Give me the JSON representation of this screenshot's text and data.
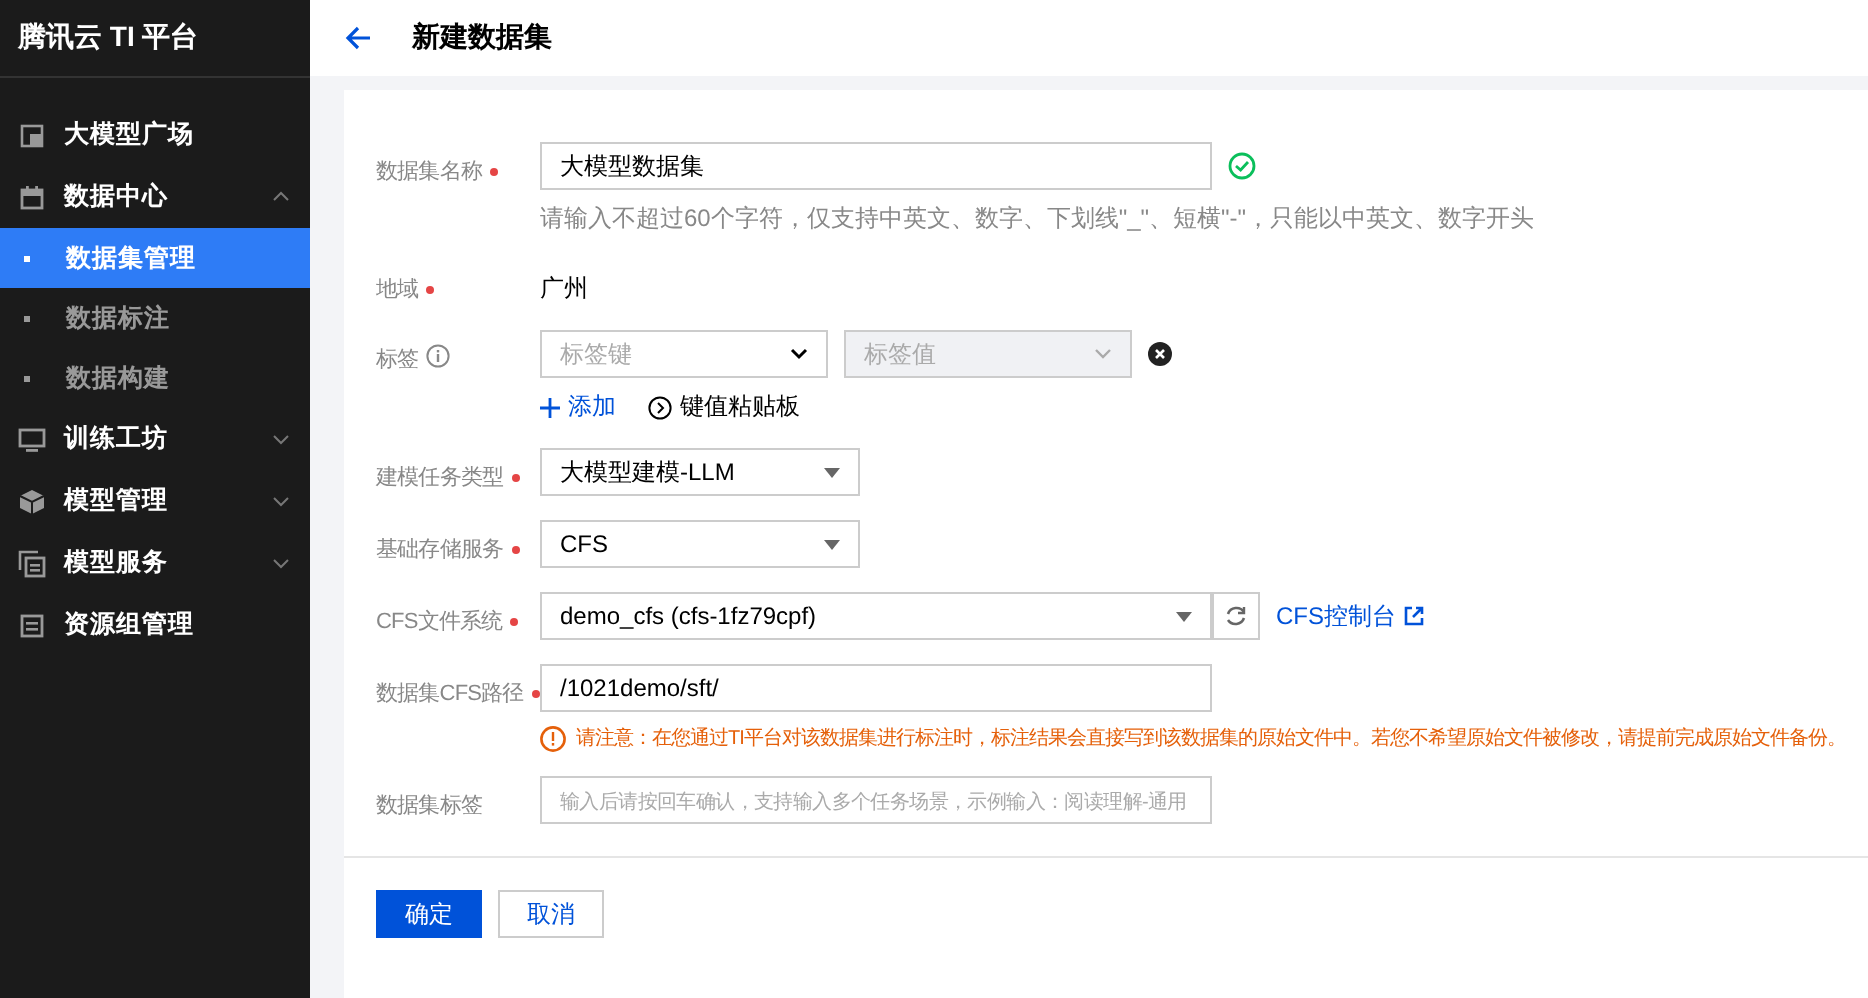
{
  "sidebar": {
    "title": "腾讯云 TI 平台",
    "items": [
      {
        "label": "大模型广场"
      },
      {
        "label": "数据中心",
        "expanded": true,
        "children": [
          {
            "label": "数据集管理",
            "selected": true
          },
          {
            "label": "数据标注",
            "selected": false
          },
          {
            "label": "数据构建",
            "selected": false
          }
        ]
      },
      {
        "label": "训练工坊",
        "expanded": false
      },
      {
        "label": "模型管理",
        "expanded": false
      },
      {
        "label": "模型服务",
        "expanded": false
      },
      {
        "label": "资源组管理"
      }
    ]
  },
  "header": {
    "title": "新建数据集"
  },
  "form": {
    "fields": [
      {
        "kind": "input",
        "label": "数据集名称",
        "required": true,
        "value": "大模型数据集",
        "valid": true,
        "hint": "请输入不超过60个字符，仅支持中英文、数字、下划线\"_\"、短横\"-\"，只能以中英文、数字开头"
      },
      {
        "kind": "text",
        "label": "地域",
        "required": true,
        "value": "广州"
      },
      {
        "kind": "tags",
        "label": "标签",
        "key_placeholder": "标签键",
        "value_placeholder": "标签值",
        "value_disabled": true,
        "actions": [
          "添加",
          "键值粘贴板"
        ]
      },
      {
        "kind": "select",
        "label": "建模任务类型",
        "required": true,
        "value": "大模型建模-LLM"
      },
      {
        "kind": "select",
        "label": "基础存储服务",
        "required": true,
        "value": "CFS"
      },
      {
        "kind": "select_refresh",
        "label": "CFS文件系统",
        "required": true,
        "value": "demo_cfs (cfs-1fz79cpf)",
        "link": "CFS控制台"
      },
      {
        "kind": "input",
        "label": "数据集CFS路径",
        "required": true,
        "value": "/1021demo/sft/",
        "warning": "请注意：在您通过TI平台对该数据集进行标注时，标注结果会直接写到该数据集的原始文件中。若您不希望原始文件被修改，请提前完成原始文件备份。"
      },
      {
        "kind": "input",
        "label": "数据集标签",
        "placeholder": "输入后请按回车确认，支持输入多个任务场景，示例输入：阅读理解-通用"
      }
    ],
    "buttons": [
      {
        "label": "确定",
        "primary": true
      },
      {
        "label": "取消",
        "primary": false
      }
    ]
  }
}
